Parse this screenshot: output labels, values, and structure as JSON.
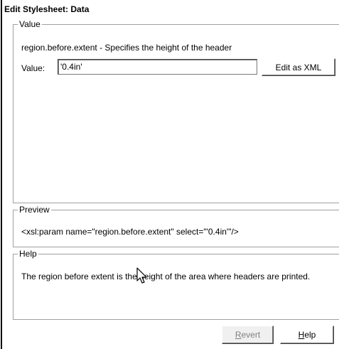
{
  "window": {
    "title": "Edit Stylesheet: Data"
  },
  "value_group": {
    "legend": "Value",
    "description": "region.before.extent - Specifies the height of the header",
    "value_label": "Value:",
    "value": "'0.4in'",
    "edit_xml_label": "Edit as XML"
  },
  "preview_group": {
    "legend": "Preview",
    "text": "<xsl:param name=\"region.before.extent\" select=\"'0.4in'\"/>"
  },
  "help_group": {
    "legend": "Help",
    "text": "The region before extent is the height of the area where headers are printed."
  },
  "buttons": {
    "revert_prefix": "",
    "revert_mnemonic": "R",
    "revert_rest": "evert",
    "revert_enabled": false,
    "help_mnemonic": "H",
    "help_rest": "elp"
  },
  "icons": {
    "cursor": "arrow-cursor-icon"
  }
}
